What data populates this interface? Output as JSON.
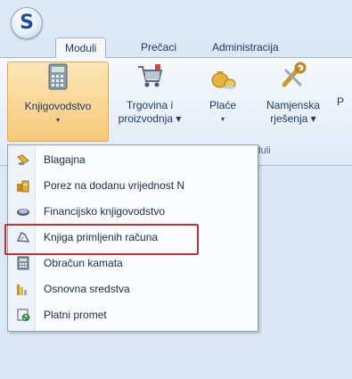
{
  "tabs": [
    "Moduli",
    "Prečaci",
    "Administracija"
  ],
  "app_button": {
    "letter": "S"
  },
  "ribbon": {
    "buttons": [
      {
        "line1": "Knjigovodstvo",
        "line2": "▾",
        "icon": "calculator-icon"
      },
      {
        "line1": "Trgovina i",
        "line2": "proizvodnja ▾",
        "icon": "shopping-cart-icon"
      },
      {
        "line1": "Plaće",
        "line2": "▾",
        "icon": "money-bags-icon"
      },
      {
        "line1": "Namjenska",
        "line2": "rješenja ▾",
        "icon": "tools-icon"
      },
      {
        "line1": "P",
        "line2": "",
        "icon": ""
      }
    ],
    "group_label": "p moduli"
  },
  "menu": {
    "items": [
      {
        "label": "Blagajna",
        "icon": "cash-register-icon"
      },
      {
        "label": "Porez na dodanu vrijednost N",
        "icon": "coins-icon"
      },
      {
        "label": "Financijsko knjigovodstvo",
        "icon": "ledger-icon"
      },
      {
        "label": "Knjiga primljenih računa",
        "icon": "invoice-book-icon"
      },
      {
        "label": "Obračun kamata",
        "icon": "calculator-small-icon"
      },
      {
        "label": "Osnovna sredstva",
        "icon": "assets-icon"
      },
      {
        "label": "Platni promet",
        "icon": "payment-icon"
      }
    ],
    "highlighted_index": 3
  },
  "colors": {
    "highlight": "#c8312e",
    "active": "#f7c879"
  }
}
